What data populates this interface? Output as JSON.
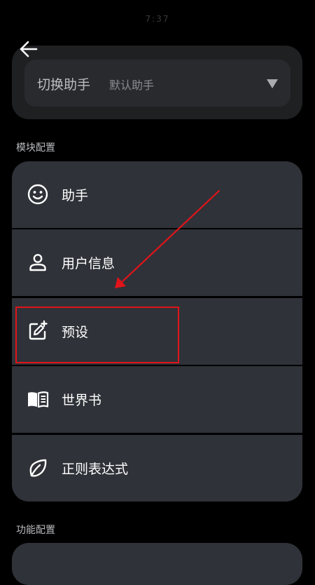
{
  "status_bar": {
    "faint_text": "7:37"
  },
  "header": {
    "back_icon": "arrow-left-icon"
  },
  "switch_assistant": {
    "label": "切换助手",
    "value": "默认助手",
    "dropdown_icon": "triangle-down-icon"
  },
  "module_section": {
    "title": "模块配置",
    "items": [
      {
        "label": "助手",
        "icon": "smiley-icon"
      },
      {
        "label": "用户信息",
        "icon": "person-icon"
      },
      {
        "label": "预设",
        "icon": "edit-plus-icon"
      },
      {
        "label": "世界书",
        "icon": "book-icon"
      },
      {
        "label": "正则表达式",
        "icon": "leaf-icon"
      }
    ]
  },
  "function_section": {
    "title": "功能配置"
  },
  "colors": {
    "background": "#000000",
    "card": "#2f3238",
    "switch_card": "#1f2022",
    "annotation": "#e0141a"
  }
}
